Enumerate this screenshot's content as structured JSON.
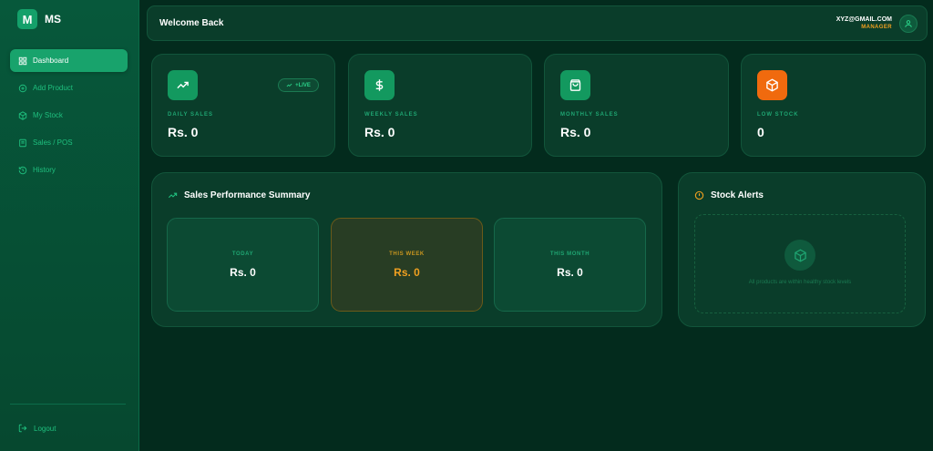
{
  "brand": {
    "logo_letter": "M",
    "name": "MS"
  },
  "sidebar": {
    "items": [
      {
        "label": "Dashboard",
        "icon": "grid-icon",
        "active": true
      },
      {
        "label": "Add Product",
        "icon": "plus-circle-icon"
      },
      {
        "label": "My Stock",
        "icon": "box-icon"
      },
      {
        "label": "Sales / POS",
        "icon": "cart-icon"
      },
      {
        "label": "History",
        "icon": "history-icon"
      }
    ],
    "logout_label": "Logout"
  },
  "header": {
    "welcome": "Welcome Back",
    "user_email": "XYZ@GMAIL.COM",
    "user_role": "MANAGER"
  },
  "stats": [
    {
      "label": "DAILY SALES",
      "value": "Rs. 0",
      "icon": "trending-up-icon",
      "badge": "+LIVE"
    },
    {
      "label": "WEEKLY SALES",
      "value": "Rs. 0",
      "icon": "dollar-icon"
    },
    {
      "label": "MONTHLY SALES",
      "value": "Rs. 0",
      "icon": "shopping-bag-icon"
    },
    {
      "label": "LOW STOCK",
      "value": "0",
      "icon": "package-icon"
    }
  ],
  "performance": {
    "title": "Sales Performance Summary",
    "tiles": [
      {
        "label": "TODAY",
        "value": "Rs. 0"
      },
      {
        "label": "THIS WEEK",
        "value": "Rs. 0"
      },
      {
        "label": "THIS MONTH",
        "value": "Rs. 0"
      }
    ]
  },
  "alerts": {
    "title": "Stock Alerts",
    "empty_text": "All products are within healthy stock levels"
  },
  "colors": {
    "accent": "#18a36c",
    "warning": "#f0a020",
    "low_stock": "#f06a0e",
    "background": "#032b1d"
  }
}
